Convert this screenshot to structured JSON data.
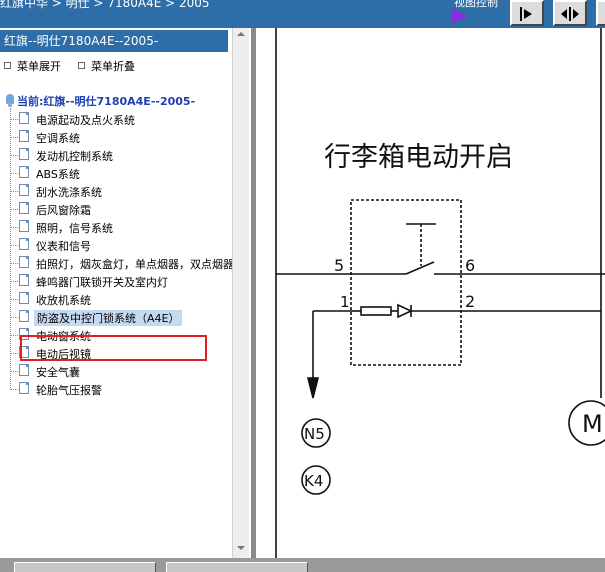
{
  "topbar": {
    "title": "红旗中华 > 明仕 > 7180A4E > 2005",
    "view_control_label": "视图控制"
  },
  "sidebar": {
    "header": "红旗--明仕7180A4E--2005-",
    "expand_label": "菜单展开",
    "collapse_label": "菜单折叠",
    "current_label": "当前:红旗--明仕7180A4E--2005-",
    "items": [
      {
        "label": "电源起动及点火系统"
      },
      {
        "label": "空调系统"
      },
      {
        "label": "发动机控制系统"
      },
      {
        "label": "ABS系统"
      },
      {
        "label": "刮水洗涤系统"
      },
      {
        "label": "后风窗除霜"
      },
      {
        "label": "照明，信号系统"
      },
      {
        "label": "仪表和信号"
      },
      {
        "label": "拍照灯，烟灰盒灯，单点烟器，双点烟器"
      },
      {
        "label": "蜂鸣器门联锁开关及室内灯"
      },
      {
        "label": "收放机系统"
      },
      {
        "label": "防盗及中控门锁系统（A4E）",
        "selected": true
      },
      {
        "label": "电动窗系统"
      },
      {
        "label": "电动后视镜"
      },
      {
        "label": "安全气囊"
      },
      {
        "label": "轮胎气压报警"
      }
    ]
  },
  "diagram": {
    "title": "行李箱电动开启",
    "pin_5": "5",
    "pin_6": "6",
    "pin_1": "1",
    "pin_2": "2",
    "node_n5": "N5",
    "node_k4": "K4",
    "motor": "M"
  },
  "colors": {
    "accent": "#2e6ea8",
    "highlight_box": "#e02020",
    "selected_bg": "#c5d9f1"
  },
  "icons": {
    "play": "play-arrow-icon",
    "step": "step-forward-icon",
    "fit": "fit-width-icon"
  }
}
